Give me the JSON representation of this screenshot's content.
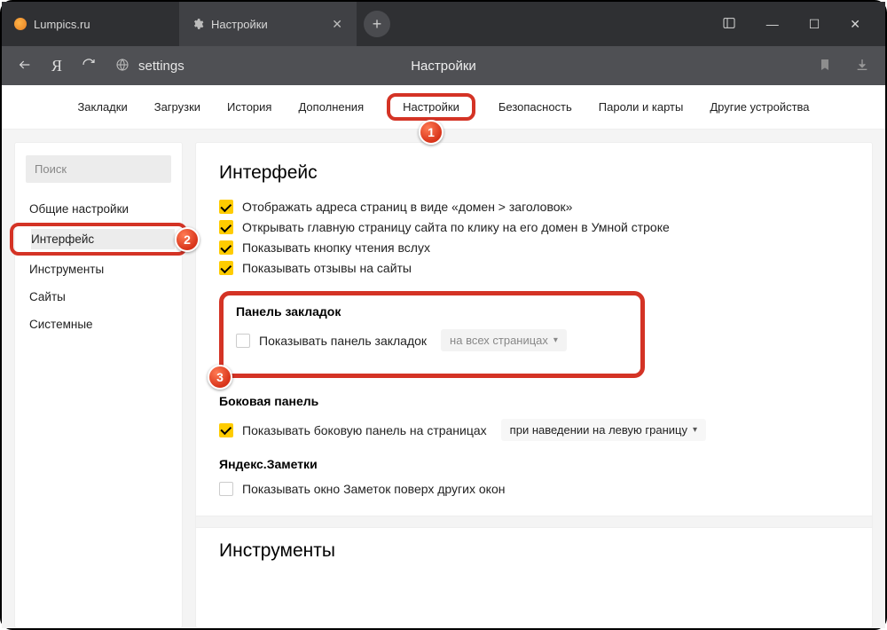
{
  "tabs": {
    "inactive": {
      "title": "Lumpics.ru"
    },
    "active": {
      "title": "Настройки"
    }
  },
  "toolbar": {
    "address": "settings",
    "page_title": "Настройки"
  },
  "topnav": {
    "items": [
      "Закладки",
      "Загрузки",
      "История",
      "Дополнения",
      "Настройки",
      "Безопасность",
      "Пароли и карты",
      "Другие устройства"
    ]
  },
  "sidebar": {
    "search_placeholder": "Поиск",
    "items": [
      "Общие настройки",
      "Интерфейс",
      "Инструменты",
      "Сайты",
      "Системные"
    ]
  },
  "interface": {
    "heading": "Интерфейс",
    "opts": [
      "Отображать адреса страниц в виде «домен > заголовок»",
      "Открывать главную страницу сайта по клику на его домен в Умной строке",
      "Показывать кнопку чтения вслух",
      "Показывать отзывы на сайты"
    ],
    "bookmarks": {
      "heading": "Панель закладок",
      "label": "Показывать панель закладок",
      "select": "на всех страницах"
    },
    "sidepanel": {
      "heading": "Боковая панель",
      "label": "Показывать боковую панель на страницах",
      "select": "при наведении на левую границу"
    },
    "notes": {
      "heading": "Яндекс.Заметки",
      "label": "Показывать окно Заметок поверх других окон"
    }
  },
  "next_section_heading": "Инструменты",
  "badges": {
    "b1": "1",
    "b2": "2",
    "b3": "3"
  }
}
